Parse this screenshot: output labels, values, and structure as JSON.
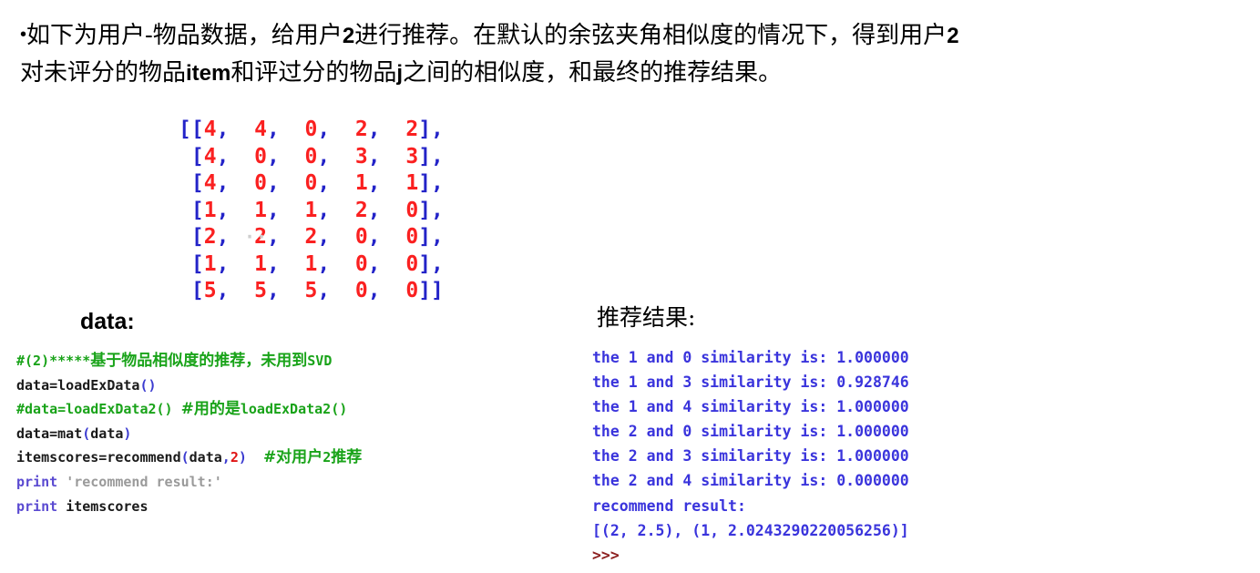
{
  "intro": {
    "bullet": "•",
    "line1_a": "如下为用户-物品数据，给用户",
    "line1_b": "2",
    "line1_c": "进行推荐。在默认的余弦夹角相似度的情况下，得到用户",
    "line1_d": "2",
    "line2_a": "对未评分的物品",
    "line2_b": "item",
    "line2_c": "和评过分的物品",
    "line2_d": "j",
    "line2_e": "之间的相似度，和最终的推荐结果。"
  },
  "data_section": {
    "label": "data:",
    "smudge": "··",
    "matrix": [
      [
        4,
        4,
        0,
        2,
        2
      ],
      [
        4,
        0,
        0,
        3,
        3
      ],
      [
        4,
        0,
        0,
        1,
        1
      ],
      [
        1,
        1,
        1,
        2,
        0
      ],
      [
        2,
        2,
        2,
        0,
        0
      ],
      [
        1,
        1,
        1,
        0,
        0
      ],
      [
        5,
        5,
        5,
        0,
        0
      ]
    ],
    "colors": {
      "punctuation": "#2323c8",
      "number": "#fa2020"
    }
  },
  "code_block": {
    "language": "python",
    "colors": {
      "comment": "#19a319",
      "keyword": "#5a4ad1",
      "string": "#9a9a9a",
      "punctuation": "#3b3bd0",
      "number": "#e01414",
      "plain": "#1a1a1a"
    },
    "lines": [
      {
        "tokens": [
          {
            "t": "#(2)*****",
            "c": "comment"
          },
          {
            "t": "基于物品相似度的推荐，未用到",
            "c": "comment",
            "cjk": true
          },
          {
            "t": "SVD",
            "c": "comment"
          }
        ]
      },
      {
        "tokens": [
          {
            "t": "data=loadExData",
            "c": "plain"
          },
          {
            "t": "()",
            "c": "punct"
          }
        ]
      },
      {
        "tokens": [
          {
            "t": "#data=loadExData2() ",
            "c": "comment"
          },
          {
            "t": "#用的是",
            "c": "comment",
            "cjk": true
          },
          {
            "t": "loadExData2()",
            "c": "comment"
          }
        ]
      },
      {
        "tokens": [
          {
            "t": "data=mat",
            "c": "plain"
          },
          {
            "t": "(",
            "c": "punct"
          },
          {
            "t": "data",
            "c": "plain"
          },
          {
            "t": ")",
            "c": "punct"
          }
        ]
      },
      {
        "tokens": [
          {
            "t": "itemscores=recommend",
            "c": "plain"
          },
          {
            "t": "(",
            "c": "punct"
          },
          {
            "t": "data",
            "c": "plain"
          },
          {
            "t": ",",
            "c": "punct"
          },
          {
            "t": "2",
            "c": "num"
          },
          {
            "t": ")",
            "c": "punct"
          },
          {
            "t": "  ",
            "c": "plain"
          },
          {
            "t": "#对用户",
            "c": "comment",
            "cjk": true
          },
          {
            "t": "2",
            "c": "comment"
          },
          {
            "t": "推荐",
            "c": "comment",
            "cjk": true
          }
        ]
      },
      {
        "tokens": [
          {
            "t": "print",
            "c": "keyword"
          },
          {
            "t": " ",
            "c": "plain"
          },
          {
            "t": "'recommend result:'",
            "c": "string"
          }
        ]
      },
      {
        "tokens": [
          {
            "t": "print",
            "c": "keyword"
          },
          {
            "t": " ",
            "c": "plain"
          },
          {
            "t": "itemscores",
            "c": "plain"
          }
        ]
      }
    ]
  },
  "output_section": {
    "label": "推荐结果:",
    "text_color": "#3a34dc",
    "prompt_color": "#8d2020",
    "lines": [
      "the 1 and 0 similarity is: 1.000000",
      "the 1 and 3 similarity is: 0.928746",
      "the 1 and 4 similarity is: 1.000000",
      "the 2 and 0 similarity is: 1.000000",
      "the 2 and 3 similarity is: 1.000000",
      "the 2 and 4 similarity is: 0.000000",
      "recommend result:",
      "[(2, 2.5), (1, 2.0243290220056256)]"
    ],
    "prompt": ">>>",
    "similarities": [
      {
        "item_i": 1,
        "item_j": 0,
        "value": 1.0
      },
      {
        "item_i": 1,
        "item_j": 3,
        "value": 0.928746
      },
      {
        "item_i": 1,
        "item_j": 4,
        "value": 1.0
      },
      {
        "item_i": 2,
        "item_j": 0,
        "value": 1.0
      },
      {
        "item_i": 2,
        "item_j": 3,
        "value": 1.0
      },
      {
        "item_i": 2,
        "item_j": 4,
        "value": 0.0
      }
    ],
    "recommend_result": [
      {
        "item": 2,
        "score": 2.5
      },
      {
        "item": 1,
        "score": 2.0243290220056256
      }
    ]
  }
}
